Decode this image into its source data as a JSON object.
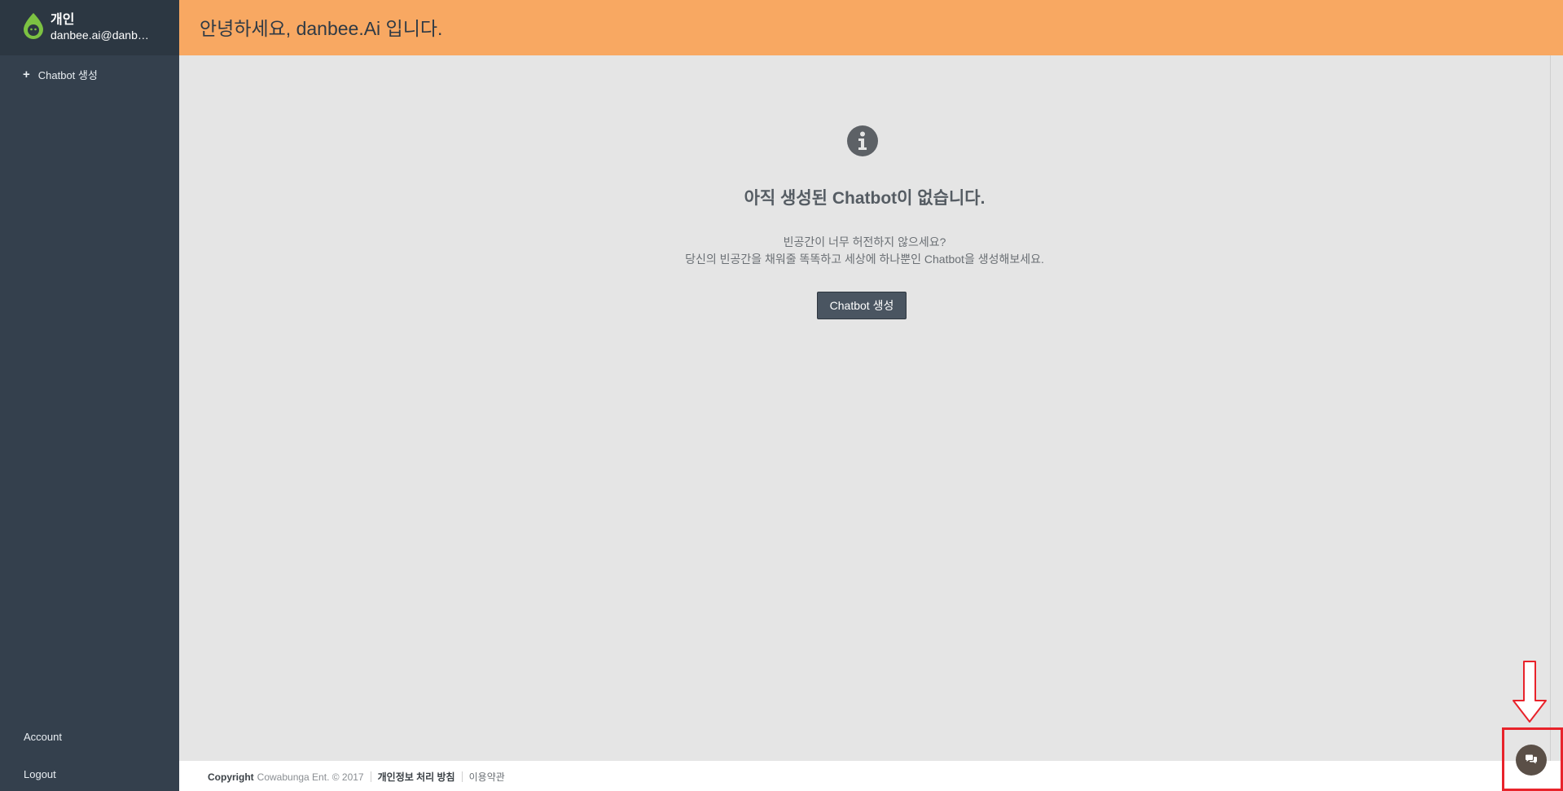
{
  "colors": {
    "sidebar_bg": "#34404d",
    "header_bg": "#f8a862",
    "main_bg": "#e5e5e5",
    "button_bg": "#4a5561",
    "chat_button_bg": "#5a4f47",
    "annotation_red": "#e8232b",
    "logo_green": "#7cc242"
  },
  "sidebar": {
    "workspace_name": "개인",
    "user_email": "danbee.ai@danbe...",
    "create_label": "Chatbot 생성",
    "create_icon": "plus-icon",
    "account_label": "Account",
    "logout_label": "Logout"
  },
  "header": {
    "greeting": "안녕하세요, danbee.Ai 입니다."
  },
  "empty_state": {
    "icon": "info-icon",
    "title": "아직 생성된 Chatbot이 없습니다.",
    "desc_line1": "빈공간이 너무 허전하지 않으세요?",
    "desc_line2": "당신의 빈공간을 채워줄 똑똑하고 세상에 하나뿐인 Chatbot을 생성해보세요.",
    "button_label": "Chatbot 생성"
  },
  "footer": {
    "copyright_label": "Copyright",
    "copyright_text": "Cowabunga Ent. © 2017",
    "privacy_label": "개인정보 처리 방침",
    "terms_label": "이용약관"
  },
  "chat_widget": {
    "icon": "chat-bubbles-icon"
  }
}
